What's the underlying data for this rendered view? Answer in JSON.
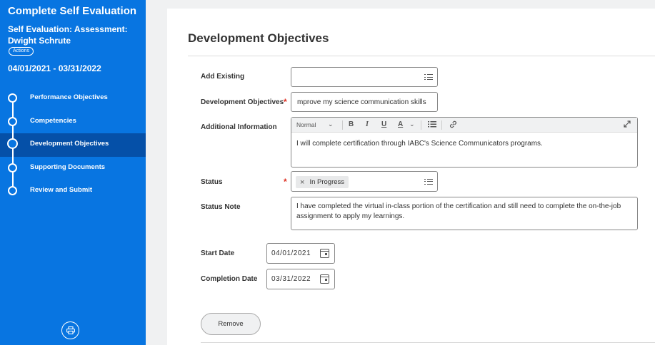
{
  "sidebar": {
    "title": "Complete Self Evaluation",
    "subtitle": "Self Evaluation: Assessment: Dwight Schrute",
    "actions_label": "Actions",
    "dates": "04/01/2021 - 03/31/2022",
    "steps": [
      {
        "label": "Performance Objectives",
        "active": false
      },
      {
        "label": "Competencies",
        "active": false
      },
      {
        "label": "Development Objectives",
        "active": true
      },
      {
        "label": "Supporting Documents",
        "active": false
      },
      {
        "label": "Review and Submit",
        "active": false
      }
    ],
    "bottom_icon": "printer-icon"
  },
  "main": {
    "title": "Development Objectives",
    "fields": {
      "add_existing": {
        "label": "Add Existing",
        "value": ""
      },
      "dev_objectives": {
        "label": "Development Objectives",
        "value": "mprove my science communication skills",
        "required_mark": "*"
      },
      "additional_info": {
        "label": "Additional Information",
        "toolbar": {
          "style": "Normal",
          "bold": "B",
          "italic": "I",
          "underline": "U",
          "color": "A"
        },
        "value": "I will complete certification through IABC's Science Communicators programs."
      },
      "status": {
        "label": "Status",
        "value": "In Progress",
        "remove_glyph": "×",
        "required_mark": "*"
      },
      "status_note": {
        "label": "Status Note",
        "value": "I have completed the virtual in-class portion of the certification and still need to complete the on-the-job assignment to apply my learnings."
      },
      "start_date": {
        "label": "Start Date",
        "value": "04/01/2021"
      },
      "completion_date": {
        "label": "Completion Date",
        "value": "03/31/2022"
      }
    },
    "remove_button": "Remove"
  },
  "colors": {
    "sidebar_bg": "#0875e1",
    "active_step": "#0550a8",
    "required": "#de2e21"
  }
}
